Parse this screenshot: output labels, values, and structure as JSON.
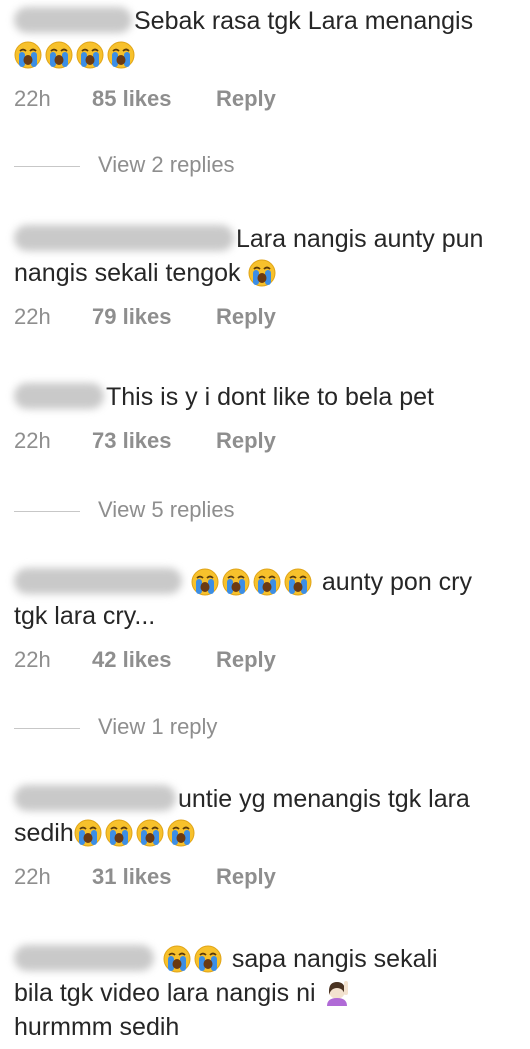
{
  "comments": [
    {
      "text_after": "Sebak rasa tgk Lara menangis",
      "text_line2": "",
      "emoji_count_line2": 4,
      "time": "22h",
      "likes": "85 likes",
      "reply": "Reply",
      "view_replies": "View 2 replies"
    },
    {
      "text_after": "Lara nangis aunty pun",
      "text_line2": "nangis sekali tengok",
      "time": "22h",
      "likes": "79 likes",
      "reply": "Reply"
    },
    {
      "text_after": "This is y i dont like to bela pet",
      "time": "22h",
      "likes": "73 likes",
      "reply": "Reply",
      "view_replies": "View 5 replies"
    },
    {
      "text_after": "aunty pon cry",
      "text_line2": "tgk lara cry...",
      "time": "22h",
      "likes": "42 likes",
      "reply": "Reply",
      "view_replies": "View 1 reply"
    },
    {
      "text_after": "untie yg menangis tgk lara",
      "text_line2": "sedih",
      "time": "22h",
      "likes": "31 likes",
      "reply": "Reply"
    },
    {
      "text_after": "sapa nangis sekali",
      "text_line2": "bila tgk video lara nangis ni",
      "text_line3": "hurmmm sedih"
    }
  ],
  "icons": {
    "crying": "loudly-crying-face-icon",
    "hand": "person-raising-hand-icon"
  },
  "colors": {
    "text": "#262626",
    "meta": "#8e8e8e",
    "emoji_face": "#f7c12c",
    "emoji_tear": "#3c8ee5"
  }
}
